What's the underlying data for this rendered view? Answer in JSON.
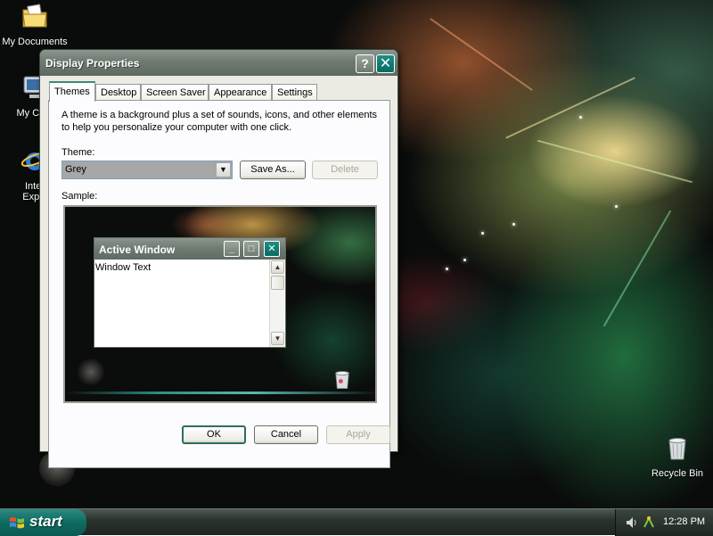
{
  "desktop": {
    "icons": [
      {
        "label": "My Documents",
        "icon": "my-documents-icon"
      },
      {
        "label": "My Com",
        "icon": "my-computer-icon"
      },
      {
        "label": "Inter",
        "label2": "Explo",
        "icon": "internet-explorer-icon"
      },
      {
        "label": "Recycle Bin",
        "icon": "recycle-bin-icon"
      }
    ]
  },
  "dialog": {
    "title": "Display Properties",
    "help_glyph": "?",
    "close_glyph": "✕",
    "tabs": [
      "Themes",
      "Desktop",
      "Screen Saver",
      "Appearance",
      "Settings"
    ],
    "active_tab": "Themes",
    "description": "A theme is a background plus a set of sounds, icons, and other elements to help you personalize your computer with one click.",
    "theme_label": "Theme:",
    "theme_value": "Grey",
    "save_as_label": "Save As...",
    "delete_label": "Delete",
    "sample_label": "Sample:",
    "preview": {
      "window_title": "Active Window",
      "window_text": "Window Text"
    },
    "ok_label": "OK",
    "cancel_label": "Cancel",
    "apply_label": "Apply"
  },
  "taskbar": {
    "start_label": "start",
    "clock": "12:28 PM"
  },
  "colors": {
    "title_bar": "#6e7a71",
    "accent_teal": "#056c63",
    "dialog_bg": "#ecebe3"
  }
}
